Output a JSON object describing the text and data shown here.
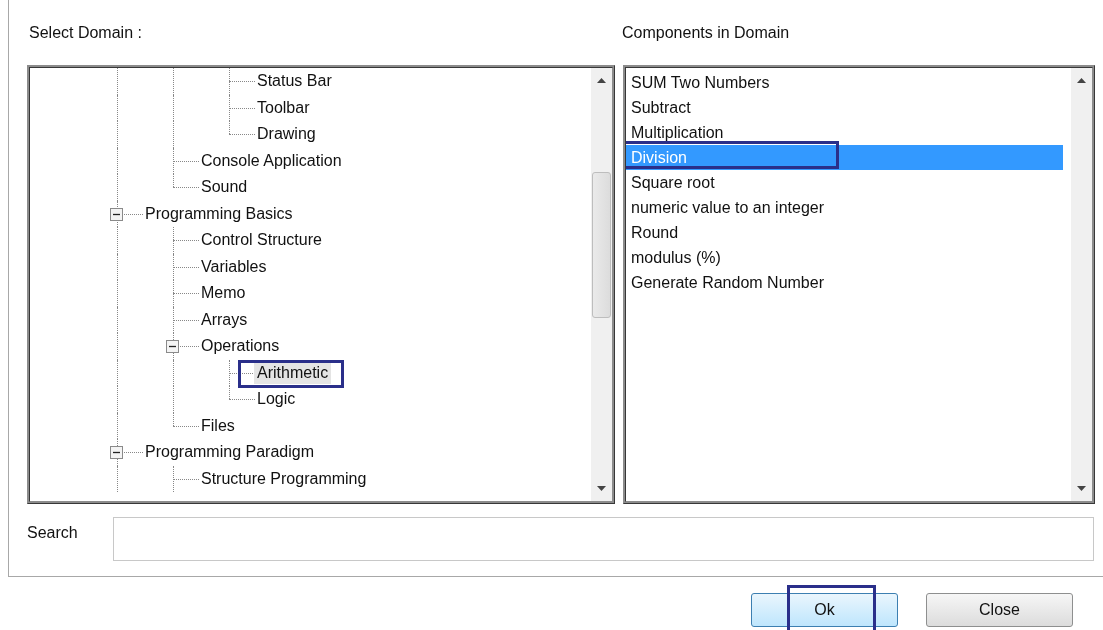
{
  "domain_label": "Select Domain :",
  "components_label": "Components in Domain",
  "tree": {
    "nodes": [
      {
        "children": [
          {
            "children": [
              {
                "label": "Status Bar",
                "selected": false,
                "annotated": false
              },
              {
                "label": "Toolbar",
                "selected": false,
                "annotated": false
              },
              {
                "label": "Drawing",
                "selected": false,
                "annotated": false
              }
            ]
          },
          {
            "label": "Console Application",
            "selected": false,
            "annotated": false
          },
          {
            "label": "Sound",
            "selected": false,
            "annotated": false
          }
        ]
      },
      {
        "label": "Programming Basics",
        "expanded": true,
        "selected": false,
        "annotated": false,
        "children": [
          {
            "label": "Control Structure",
            "selected": false,
            "annotated": false
          },
          {
            "label": "Variables",
            "selected": false,
            "annotated": false
          },
          {
            "label": "Memo",
            "selected": false,
            "annotated": false
          },
          {
            "label": "Arrays",
            "selected": false,
            "annotated": false
          },
          {
            "label": "Operations",
            "expanded": true,
            "selected": false,
            "annotated": false,
            "children": [
              {
                "label": "Arithmetic",
                "selected": true,
                "annotated": true
              },
              {
                "label": "Logic",
                "selected": false,
                "annotated": false
              }
            ]
          },
          {
            "label": "Files",
            "selected": false,
            "annotated": false
          }
        ]
      },
      {
        "label": "Programming Paradigm",
        "expanded": true,
        "selected": false,
        "annotated": false,
        "children": [
          {
            "label": "Structure Programming",
            "selected": false,
            "annotated": false
          }
        ]
      }
    ]
  },
  "components": [
    {
      "label": "SUM Two Numbers",
      "selected": false,
      "annotated": false
    },
    {
      "label": "Subtract",
      "selected": false,
      "annotated": false
    },
    {
      "label": "Multiplication",
      "selected": false,
      "annotated": false
    },
    {
      "label": "Division",
      "selected": true,
      "annotated": true
    },
    {
      "label": "Square root",
      "selected": false,
      "annotated": false
    },
    {
      "label": "numeric value to an integer",
      "selected": false,
      "annotated": false
    },
    {
      "label": "Round",
      "selected": false,
      "annotated": false
    },
    {
      "label": "modulus (%)",
      "selected": false,
      "annotated": false
    },
    {
      "label": "Generate Random Number",
      "selected": false,
      "annotated": false
    }
  ],
  "search": {
    "label": "Search"
  },
  "buttons": [
    {
      "label": "Ok",
      "focused": true,
      "annotated": true
    },
    {
      "label": "Close",
      "focused": false,
      "annotated": false
    }
  ]
}
